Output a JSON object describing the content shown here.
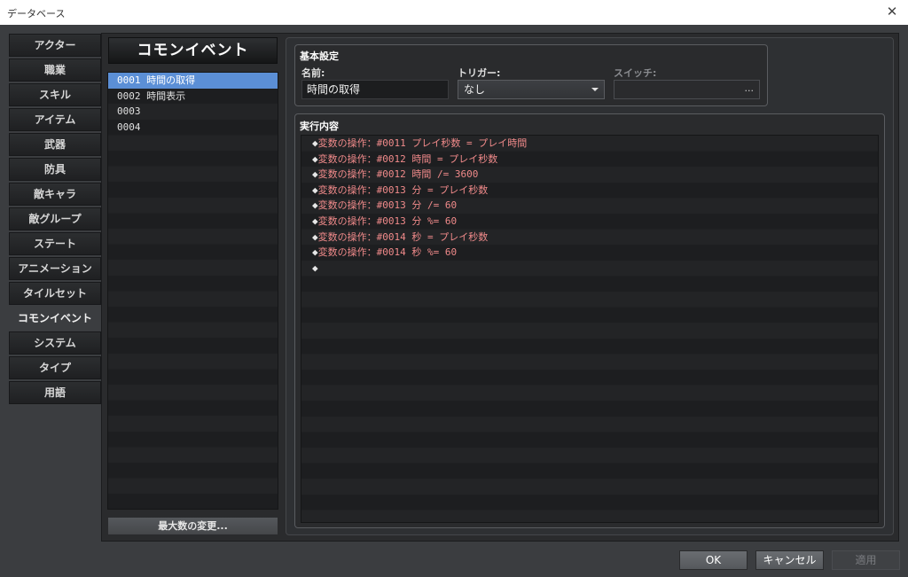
{
  "window": {
    "title": "データベース"
  },
  "tabs": [
    {
      "label": "アクター"
    },
    {
      "label": "職業"
    },
    {
      "label": "スキル"
    },
    {
      "label": "アイテム"
    },
    {
      "label": "武器"
    },
    {
      "label": "防具"
    },
    {
      "label": "敵キャラ"
    },
    {
      "label": "敵グループ"
    },
    {
      "label": "ステート"
    },
    {
      "label": "アニメーション"
    },
    {
      "label": "タイルセット"
    },
    {
      "label": "コモンイベント"
    },
    {
      "label": "システム"
    },
    {
      "label": "タイプ"
    },
    {
      "label": "用語"
    }
  ],
  "active_tab": "コモンイベント",
  "common_events": {
    "header": "コモンイベント",
    "items": [
      {
        "label": "0001 時間の取得",
        "selected": true
      },
      {
        "label": "0002 時間表示",
        "selected": false
      },
      {
        "label": "0003",
        "selected": false
      },
      {
        "label": "0004",
        "selected": false
      }
    ],
    "max_button": "最大数の変更..."
  },
  "basic_settings": {
    "title": "基本設定",
    "name_label": "名前:",
    "name_value": "時間の取得",
    "trigger_label": "トリガー:",
    "trigger_value": "なし",
    "switch_label": "スイッチ:",
    "switch_button": "..."
  },
  "contents": {
    "title": "実行内容",
    "commands": [
      "変数の操作：#0011 プレイ秒数 = プレイ時間",
      "変数の操作：#0012 時間 = プレイ秒数",
      "変数の操作：#0012 時間 /= 3600",
      "変数の操作：#0013 分 = プレイ秒数",
      "変数の操作：#0013 分 /= 60",
      "変数の操作：#0013 分 %= 60",
      "変数の操作：#0014 秒 = プレイ秒数",
      "変数の操作：#0014 秒 %= 60",
      ""
    ],
    "diamond": "◆"
  },
  "buttons": {
    "ok": "OK",
    "cancel": "キャンセル",
    "apply": "適用"
  },
  "colors": {
    "selection": "#5b8fd6",
    "command_text": "#f08a8a"
  }
}
